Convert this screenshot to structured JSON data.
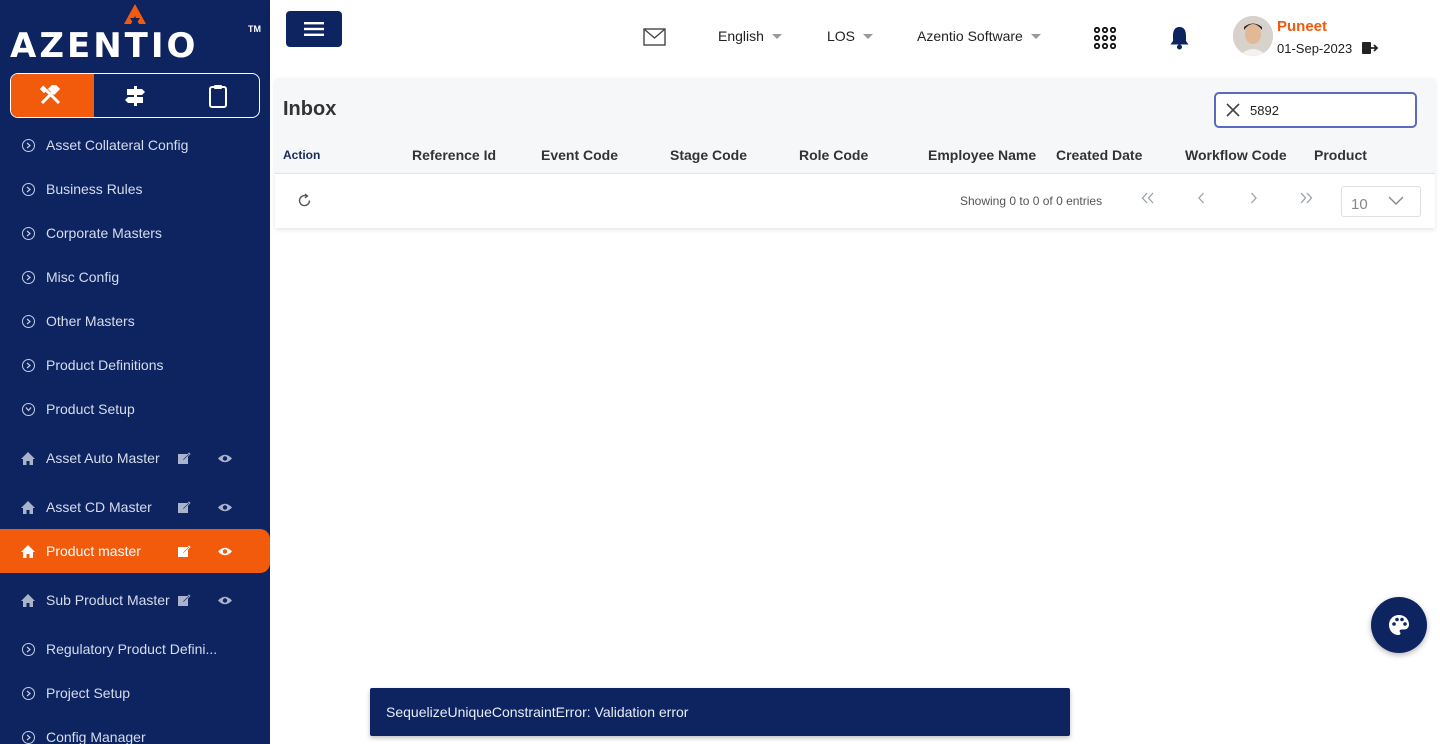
{
  "brand": {
    "name": "AZENTIO",
    "tm": "TM"
  },
  "sidebar": {
    "mode_tabs": [
      "tools",
      "signpost",
      "clipboard"
    ],
    "items": [
      {
        "label": "Asset Collateral Config",
        "type": "section"
      },
      {
        "label": "Business Rules",
        "type": "section"
      },
      {
        "label": "Corporate Masters",
        "type": "section"
      },
      {
        "label": "Misc Config",
        "type": "section"
      },
      {
        "label": "Other Masters",
        "type": "section"
      },
      {
        "label": "Product Definitions",
        "type": "section"
      },
      {
        "label": "Product Setup",
        "type": "section",
        "expanded": true
      },
      {
        "label": "Asset Auto Master",
        "type": "page"
      },
      {
        "label": "Asset CD Master",
        "type": "page"
      },
      {
        "label": "Product master",
        "type": "page",
        "active": true
      },
      {
        "label": "Sub Product Master",
        "type": "page"
      },
      {
        "label": "Regulatory Product Defini...",
        "type": "section"
      },
      {
        "label": "Project Setup",
        "type": "section"
      },
      {
        "label": "Config Manager",
        "type": "section"
      }
    ]
  },
  "header": {
    "language": "English",
    "module": "LOS",
    "company": "Azentio Software",
    "user": {
      "name": "Puneet",
      "date": "01-Sep-2023"
    }
  },
  "inbox": {
    "title": "Inbox",
    "search_value": "5892",
    "columns": [
      "Action",
      "Reference Id",
      "Event Code",
      "Stage Code",
      "Role Code",
      "Employee Name",
      "Created Date",
      "Workflow Code",
      "Product"
    ],
    "showing": "Showing 0 to 0 of 0 entries",
    "page_size": "10"
  },
  "toast": {
    "message": "SequelizeUniqueConstraintError: Validation error"
  },
  "colors": {
    "navy": "#0d2461",
    "accent": "#f25a0c"
  }
}
